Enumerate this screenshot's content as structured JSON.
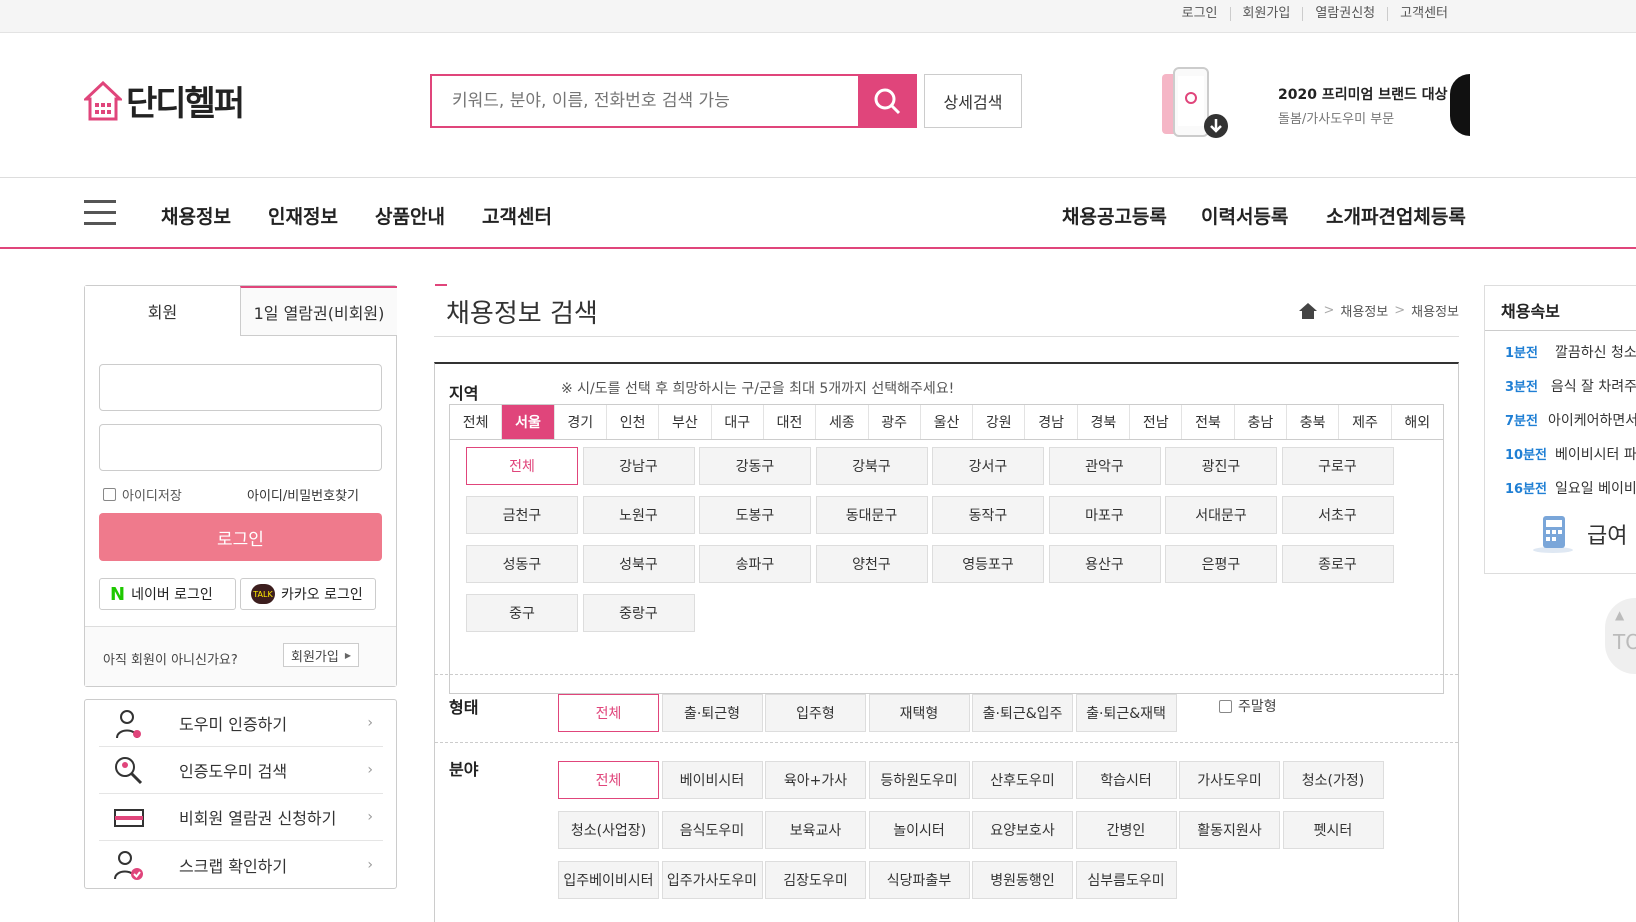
{
  "topbar": {
    "links": [
      "로그인",
      "회원가입",
      "열람권신청",
      "고객센터"
    ]
  },
  "header": {
    "logo_text": "단디헬퍼",
    "search_placeholder": "키워드, 분야, 이름, 전화번호 검색 가능",
    "detail_search": "상세검색",
    "brand_line1": "2020 프리미엄 브랜드 대상",
    "brand_line2": "돌봄/가사도우미 부문"
  },
  "nav": {
    "left": [
      "채용정보",
      "인재정보",
      "상품안내",
      "고객센터"
    ],
    "right": [
      "채용공고등록",
      "이력서등록",
      "소개파견업체등록"
    ]
  },
  "login": {
    "tab_member": "회원",
    "tab_guest": "1일 열람권(비회원)",
    "save_id": "아이디저장",
    "find_id": "아이디/비밀번호찾기",
    "login_btn": "로그인",
    "naver": "네이버 로그인",
    "kakao": "카카오 로그인",
    "not_member": "아직 회원이 아니신가요?",
    "join": "회원가입"
  },
  "quick_links": [
    "도우미 인증하기",
    "인증도우미 검색",
    "비회원 열람권 신청하기",
    "스크랩 확인하기"
  ],
  "main": {
    "title": "채용정보 검색",
    "breadcrumb": [
      "채용정보",
      "채용정보"
    ],
    "region_label": "지역",
    "region_note": "※ 시/도를 선택 후 희망하시는 구/군을 최대 5개까지 선택해주세요!",
    "regions": [
      "전체",
      "서울",
      "경기",
      "인천",
      "부산",
      "대구",
      "대전",
      "세종",
      "광주",
      "울산",
      "강원",
      "경남",
      "경북",
      "전남",
      "전북",
      "충남",
      "충북",
      "제주",
      "해외"
    ],
    "selected_region": "서울",
    "districts": [
      "전체",
      "강남구",
      "강동구",
      "강북구",
      "강서구",
      "관악구",
      "광진구",
      "구로구",
      "금천구",
      "노원구",
      "도봉구",
      "동대문구",
      "동작구",
      "마포구",
      "서대문구",
      "서초구",
      "성동구",
      "성북구",
      "송파구",
      "양천구",
      "영등포구",
      "용산구",
      "은평구",
      "종로구",
      "중구",
      "중랑구"
    ],
    "type_label": "형태",
    "types": [
      "전체",
      "출·퇴근형",
      "입주형",
      "재택형",
      "출·퇴근&입주",
      "출·퇴근&재택"
    ],
    "weekend": "주말형",
    "field_label": "분야",
    "fields": [
      "전체",
      "베이비시터",
      "육아+가사",
      "등하원도우미",
      "산후도우미",
      "학습시터",
      "가사도우미",
      "청소(가정)",
      "청소(사업장)",
      "음식도우미",
      "보육교사",
      "놀이시터",
      "요양보호사",
      "간병인",
      "활동지원사",
      "펫시터",
      "입주베이비시터",
      "입주가사도우미",
      "김장도우미",
      "식당파출부",
      "병원동행인",
      "심부름도우미"
    ]
  },
  "news": {
    "title": "채용속보",
    "items": [
      {
        "time": "1분전",
        "text": "깔끔하신 청소"
      },
      {
        "time": "3분전",
        "text": "음식 잘 차려주"
      },
      {
        "time": "7분전",
        "text": "아이케어하면서"
      },
      {
        "time": "10분전",
        "text": "베이비시터 파"
      },
      {
        "time": "16분전",
        "text": "일요일 베이비"
      }
    ],
    "calc_label": "급여"
  },
  "top_button": "TO",
  "colors": {
    "accent": "#e0457b",
    "login_btn": "#ef7a8c",
    "news_time": "#1f7fd4"
  }
}
